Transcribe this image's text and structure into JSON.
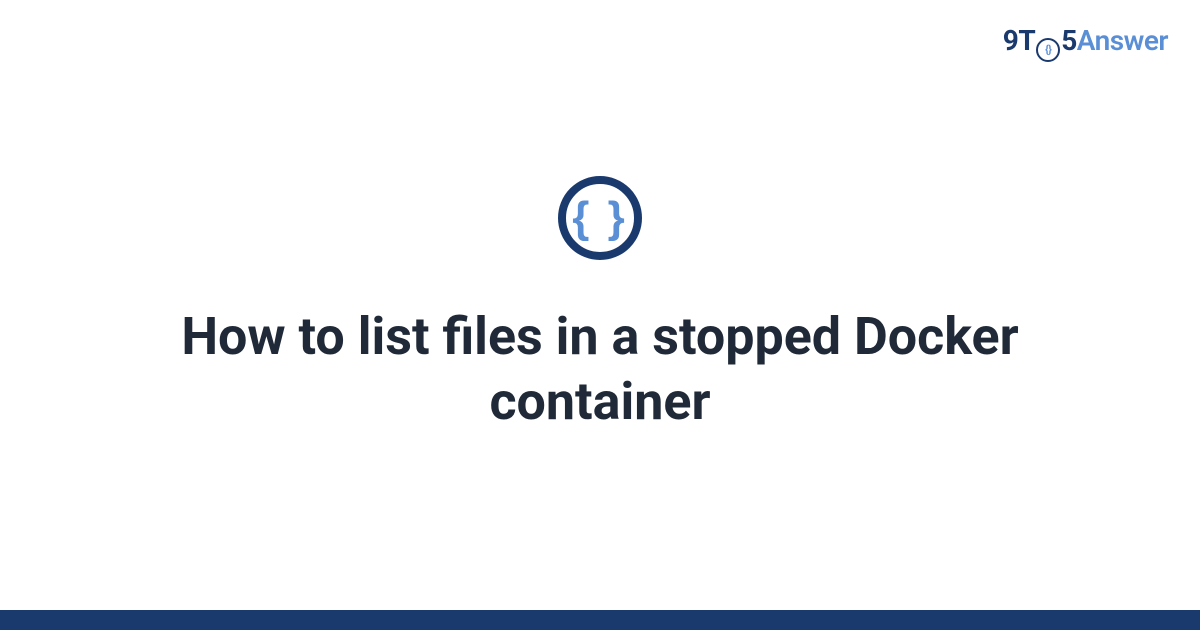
{
  "brand": {
    "nine": "9",
    "t": "T",
    "o_inner": "{}",
    "five": "5",
    "answer": "Answer"
  },
  "icon": {
    "braces": "{ }"
  },
  "title": "How to list files in a stopped Docker container",
  "colors": {
    "dark_blue": "#1a3a6e",
    "light_blue": "#5a8fd6",
    "text": "#1f2937"
  }
}
